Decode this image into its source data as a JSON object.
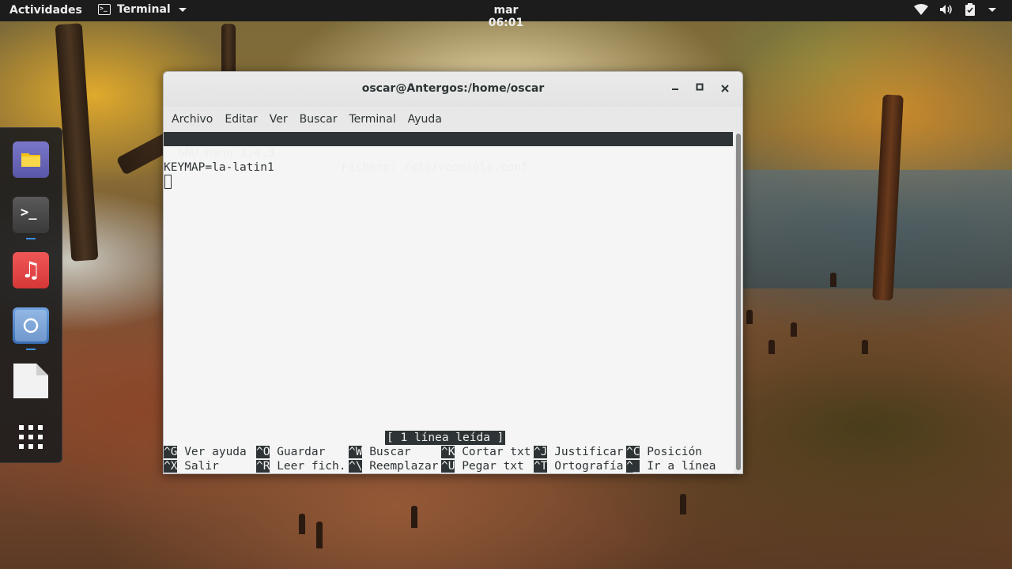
{
  "topbar": {
    "activities": "Actividades",
    "app_name": "Terminal",
    "clock": "mar 06:01",
    "icons": [
      "wifi-icon",
      "volume-icon",
      "battery-icon",
      "system-menu-caret-icon"
    ]
  },
  "dash": {
    "apps": [
      {
        "name": "files-icon",
        "running": false
      },
      {
        "name": "terminal-icon",
        "running": true
      },
      {
        "name": "music-icon",
        "running": false
      },
      {
        "name": "browser-icon",
        "running": true
      },
      {
        "name": "document-icon",
        "running": false
      },
      {
        "name": "show-applications-icon",
        "running": false
      }
    ]
  },
  "window": {
    "title": "oscar@Antergos:/home/oscar",
    "menu": {
      "archivo": "Archivo",
      "editar": "Editar",
      "ver": "Ver",
      "buscar": "Buscar",
      "terminal": "Terminal",
      "ayuda": "Ayuda"
    }
  },
  "nano": {
    "version": "GNU nano 2.4.3",
    "file": "Fichero: /etc/vconsole.conf",
    "content": "KEYMAP=la-latin1",
    "status": "[ 1 línea leída ]",
    "shortcuts_row1": [
      {
        "key": "^G",
        "label": " Ver ayuda"
      },
      {
        "key": "^O",
        "label": " Guardar"
      },
      {
        "key": "^W",
        "label": " Buscar"
      },
      {
        "key": "^K",
        "label": " Cortar txt"
      },
      {
        "key": "^J",
        "label": " Justificar"
      },
      {
        "key": "^C",
        "label": " Posición"
      }
    ],
    "shortcuts_row2": [
      {
        "key": "^X",
        "label": " Salir"
      },
      {
        "key": "^R",
        "label": " Leer fich."
      },
      {
        "key": "^\\",
        "label": " Reemplazar"
      },
      {
        "key": "^U",
        "label": " Pegar txt"
      },
      {
        "key": "^T",
        "label": " Ortografía"
      },
      {
        "key": "^_",
        "label": " Ir a línea"
      }
    ]
  },
  "colors": {
    "topbar_bg": "#1c1c1c",
    "terminal_bg": "#f5f5f5",
    "terminal_fg": "#2e3436",
    "inverse_bg": "#2e3436"
  }
}
